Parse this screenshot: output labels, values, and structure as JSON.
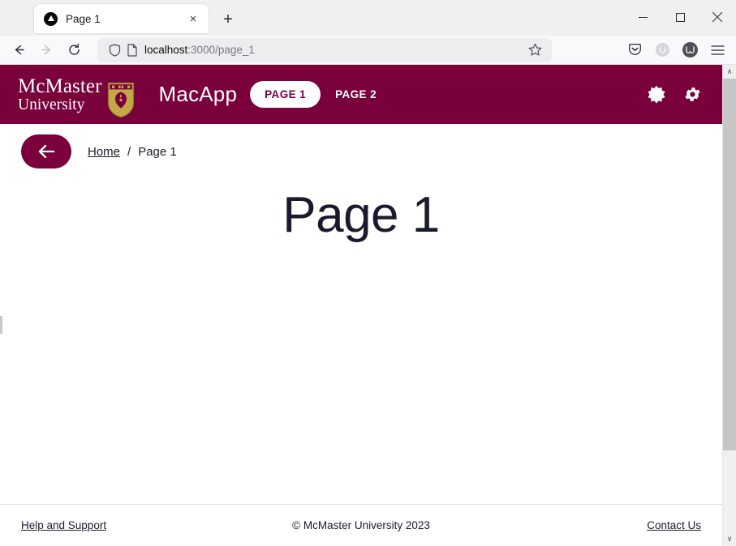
{
  "browser": {
    "tab": {
      "title": "Page 1",
      "favicon": "triangle-circle-icon",
      "close": "×"
    },
    "newtab_label": "+",
    "window_controls": {
      "minimize": "–",
      "maximize": "□",
      "close": "×"
    },
    "nav": {
      "back": "←",
      "forward": "→",
      "reload": "⟳"
    },
    "url": {
      "host": "localhost",
      "rest": ":3000/page_1",
      "full": "localhost:3000/page_1"
    },
    "toolbar_icons": [
      "pocket-icon",
      "account-circle-icon",
      "extension-avatar-icon",
      "hamburger-menu-icon"
    ]
  },
  "header": {
    "logo": {
      "line1": "McMaster",
      "line2": "University",
      "crest": "mcmaster-crest-icon"
    },
    "app_name": "MacApp",
    "nav_items": [
      {
        "label": "PAGE 1",
        "active": true
      },
      {
        "label": "PAGE 2",
        "active": false
      }
    ],
    "actions": [
      {
        "name": "dark-mode-toggle",
        "icon": "contrast-icon"
      },
      {
        "name": "settings-button",
        "icon": "gear-icon"
      }
    ],
    "brand_color": "#7a003c"
  },
  "breadcrumb": {
    "back_icon": "arrow-left-icon",
    "items": [
      {
        "label": "Home",
        "link": true
      },
      {
        "label": "Page 1",
        "link": false
      }
    ],
    "separator": "/"
  },
  "main": {
    "title": "Page 1"
  },
  "footer": {
    "help_label": "Help and Support",
    "copyright": "© McMaster University 2023",
    "contact_label": "Contact Us"
  },
  "scrollbar": {
    "up": "∧",
    "down": "∨"
  }
}
